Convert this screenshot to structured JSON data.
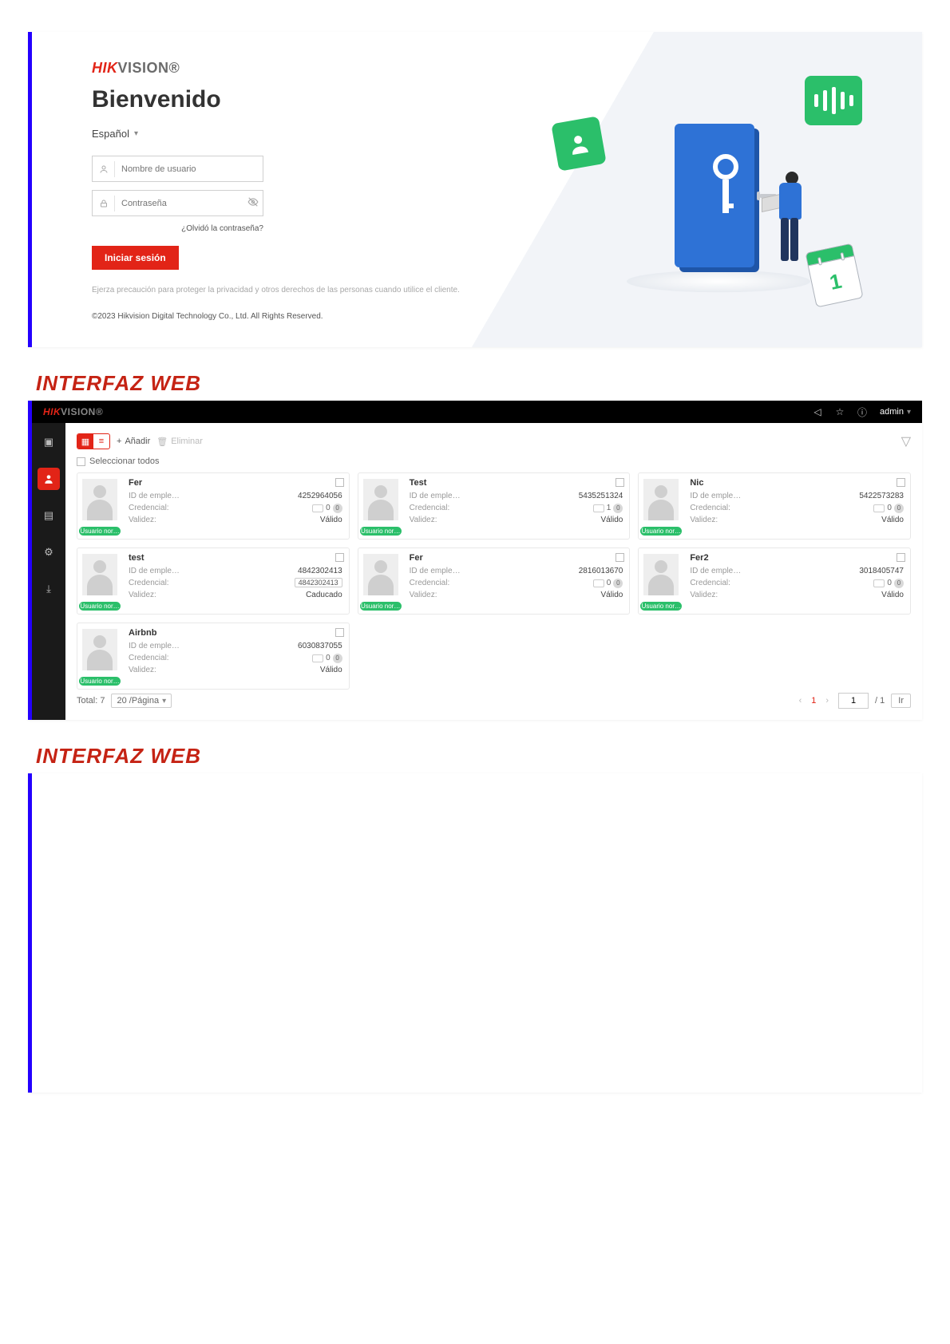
{
  "login": {
    "brand_hik": "HIK",
    "brand_rest": "VISION®",
    "welcome": "Bienvenido",
    "language": "Español",
    "username_ph": "Nombre de usuario",
    "password_ph": "Contraseña",
    "forgot": "¿Olvidó la contraseña?",
    "submit": "Iniciar sesión",
    "caution": "Ejerza precaución para proteger la privacidad y otros derechos de las personas cuando utilice el cliente.",
    "copyright": "©2023 Hikvision Digital Technology Co., Ltd. All Rights Reserved.",
    "calendar_date": "1"
  },
  "section_title_1": "INTERFAZ WEB",
  "section_title_2": "INTERFAZ WEB",
  "admin": {
    "topbar": {
      "brand_hik": "HIK",
      "brand_rest": "VISION®",
      "user": "admin"
    },
    "toolbar": {
      "add": "Añadir",
      "delete": "Eliminar",
      "select_all": "Seleccionar todos"
    },
    "labels": {
      "id": "ID de emple…",
      "credential": "Credencial:",
      "validity": "Validez:",
      "user_badge": "Usuario nor…"
    },
    "cards": [
      {
        "name": "Fer",
        "id": "4252964056",
        "cred_card": "0",
        "cred_fp": "0",
        "validity": "Válido",
        "id_boxed": false
      },
      {
        "name": "Test",
        "id": "5435251324",
        "cred_card": "1",
        "cred_fp": "0",
        "validity": "Válido",
        "id_boxed": false
      },
      {
        "name": "Nic",
        "id": "5422573283",
        "cred_card": "0",
        "cred_fp": "0",
        "validity": "Válido",
        "id_boxed": false
      },
      {
        "name": "test",
        "id": "4842302413",
        "cred_card": "",
        "cred_fp": "",
        "validity": "Caducado",
        "id_boxed": true,
        "id_box_val": "4842302413"
      },
      {
        "name": "Fer",
        "id": "2816013670",
        "cred_card": "0",
        "cred_fp": "0",
        "validity": "Válido",
        "id_boxed": false
      },
      {
        "name": "Fer2",
        "id": "3018405747",
        "cred_card": "0",
        "cred_fp": "0",
        "validity": "Válido",
        "id_boxed": false
      },
      {
        "name": "Airbnb",
        "id": "6030837055",
        "cred_card": "0",
        "cred_fp": "0",
        "validity": "Válido",
        "id_boxed": false
      }
    ],
    "pager": {
      "total_label": "Total: 7",
      "page_size": "20 /Página",
      "current": "1",
      "total_pages": "/ 1",
      "goto_val": "1",
      "go_label": "Ir"
    }
  }
}
